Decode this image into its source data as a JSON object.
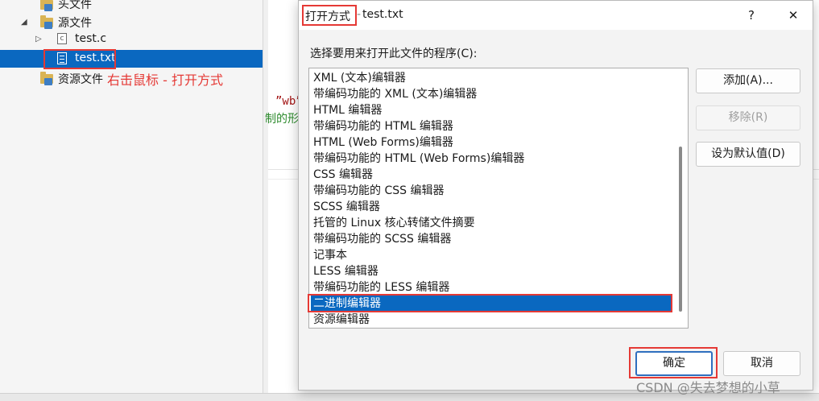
{
  "explorer": {
    "items": [
      {
        "label": "头文件"
      },
      {
        "label": "源文件"
      },
      {
        "label": "test.c"
      },
      {
        "label": "test.txt"
      },
      {
        "label": "资源文件"
      }
    ],
    "annotation": "右击鼠标 - 打开方式"
  },
  "editor": {
    "string_fragment": "”wb”",
    "comment_fragment": "制的形"
  },
  "dialog": {
    "title_prefix": "打开方式",
    "title_separator": "-",
    "title_file": "test.txt",
    "help_label": "?",
    "close_label": "✕",
    "prompt": "选择要用来打开此文件的程序(C):",
    "programs": [
      "XML (文本)编辑器",
      "带编码功能的 XML (文本)编辑器",
      "HTML 编辑器",
      "带编码功能的 HTML 编辑器",
      "HTML (Web Forms)编辑器",
      "带编码功能的 HTML (Web Forms)编辑器",
      "CSS 编辑器",
      "带编码功能的 CSS 编辑器",
      "SCSS 编辑器",
      "托管的 Linux 核心转储文件摘要",
      "带编码功能的 SCSS 编辑器",
      "记事本",
      "LESS 编辑器",
      "带编码功能的 LESS 编辑器",
      "二进制编辑器",
      "资源编辑器"
    ],
    "selected_program": "二进制编辑器",
    "buttons": {
      "add": "添加(A)...",
      "remove": "移除(R)",
      "set_default": "设为默认值(D)",
      "ok": "确定",
      "cancel": "取消"
    }
  },
  "watermark": "CSDN @失去梦想的小草",
  "colors": {
    "selection": "#0a68c0",
    "annotation_red": "#e53935"
  }
}
